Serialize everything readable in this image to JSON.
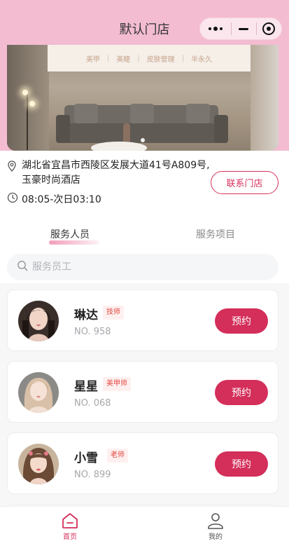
{
  "nav": {
    "title": "默认门店"
  },
  "banner": {
    "sign_items": [
      "美甲",
      "美睫",
      "皮肤管理",
      "半永久"
    ]
  },
  "store": {
    "address": "湖北省宜昌市西陵区发展大道41号A809号,玉豪时尚酒店",
    "hours": "08:05-次日03:10",
    "contact_label": "联系门店"
  },
  "tabs": [
    {
      "label": "服务人员",
      "active": true
    },
    {
      "label": "服务项目",
      "active": false
    }
  ],
  "search": {
    "placeholder": "服务员工"
  },
  "staff": [
    {
      "name": "琳达",
      "role": "技师",
      "number": "NO. 958",
      "book_label": "预约"
    },
    {
      "name": "星星",
      "role": "美甲师",
      "number": "NO. 068",
      "book_label": "预约"
    },
    {
      "name": "小雪",
      "role": "老师",
      "number": "NO. 899",
      "book_label": "预约"
    }
  ],
  "tabbar": [
    {
      "label": "首页",
      "active": true,
      "icon": "home-icon"
    },
    {
      "label": "我的",
      "active": false,
      "icon": "user-icon"
    }
  ],
  "colors": {
    "accent": "#d42e5a",
    "header": "#f3bcd0",
    "tag_text": "#e0483f"
  }
}
